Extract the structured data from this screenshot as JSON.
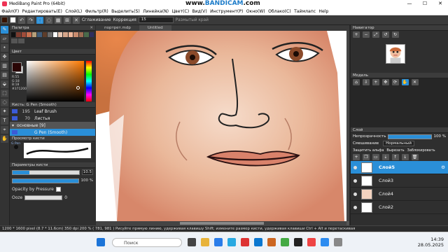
{
  "window": {
    "title": "MediBang Paint Pro (64bit)",
    "watermark_prefix": "www.",
    "watermark_brand": "BANDICAM",
    "watermark_suffix": ".com"
  },
  "menu": [
    "Файл(F)",
    "Редактировать(E)",
    "Слой(L)",
    "Фильтр(R)",
    "Выделить(S)",
    "Линейка(N)",
    "Цвет(C)",
    "Вид(V)",
    "Инструмент(P)",
    "Окно(W)",
    "Облако(C)",
    "Таймлапс",
    "Help"
  ],
  "toolbar": {
    "smoothing_label": "Сглаживание",
    "correction_label": "Коррекция",
    "correction_value": "15",
    "edge_label": "Размытый край"
  },
  "palette": {
    "title": "Палитра",
    "colors": [
      "#111111",
      "#7a3b2e",
      "#a04c3a",
      "#c9704f",
      "#b7a07a",
      "#3f5d7b",
      "#5e3d2a",
      "#6b6b6b",
      "#ffffff",
      "#e8c8b4",
      "#d7a68a",
      "#f0b79a",
      "#c98b6e",
      "#9e6b52",
      "#4a6a4a",
      "#2e2e5e"
    ]
  },
  "color": {
    "title": "Цвет",
    "r": "R:55",
    "g": "G:18",
    "b": "B:18",
    "hex": "#371200",
    "accent": "#2a8fd8"
  },
  "brush": {
    "title": "Кисть: G Pen (Smooth)",
    "items": [
      {
        "num": "195",
        "name": "Leaf Brush",
        "swatch": "#3b5bd6"
      },
      {
        "num": "70",
        "name": "Листья",
        "swatch": "#3b5bd6"
      },
      {
        "num": "",
        "name": "основные [9]",
        "swatch": ""
      },
      {
        "num": "",
        "name": "G Pen (Smooth)",
        "swatch": "#3b5bd6"
      }
    ]
  },
  "brush_preview": {
    "title": "Просмотр кисти",
    "tag": "G Pen"
  },
  "brush_params": {
    "title": "Параметры кисти",
    "size_value": "10.5",
    "opacity_value": "100 %",
    "pressure_label": "Opacity by Pressure",
    "ooze_label": "Ooze",
    "ooze_value": "0"
  },
  "canvas": {
    "tabs": [
      "портрет.mdp",
      "Untitled"
    ]
  },
  "navigator": {
    "title": "Навигатор"
  },
  "model": {
    "title": "Модель"
  },
  "layer": {
    "title": "Слой",
    "opacity_label": "Непрозрачность",
    "opacity_value": "100 %",
    "blend_label": "Смешивание",
    "blend_value": "Нормальный",
    "options": [
      "Защитить альфа",
      "Вырезать",
      "Заблокировать"
    ],
    "layers": [
      "Слой5",
      "Слой3",
      "Слой4",
      "Слой2"
    ]
  },
  "status": {
    "text": "1200 * 1600 pixel   (8.7 * 11.6cm)   350 dpi   200 %   ( 781, 981 )   Рисуйте прямую линию, удерживая клавишу Shift; измените размер кисти, удерживая клавиши Ctrl + Alt и перетаскивая"
  },
  "taskbar": {
    "search": "Поиск",
    "time": "14:39",
    "date": "28.05.2025"
  }
}
